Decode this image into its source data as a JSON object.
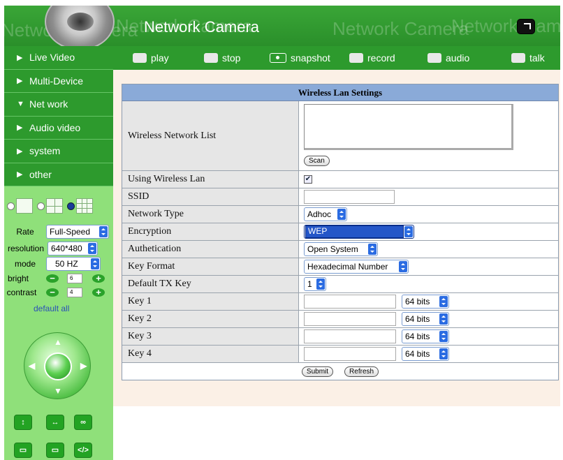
{
  "header": {
    "title": "Network Camera",
    "watermark": "Network Camera"
  },
  "sidebar": {
    "items": [
      {
        "label": "Live Video",
        "arrow": "▶"
      },
      {
        "label": "Multi-Device",
        "arrow": "▶"
      },
      {
        "label": "Net work",
        "arrow": "▼"
      },
      {
        "label": "Audio video",
        "arrow": "▶"
      },
      {
        "label": "system",
        "arrow": "▶"
      },
      {
        "label": "other",
        "arrow": "▶"
      }
    ],
    "controls": {
      "rate_label": "Rate",
      "rate_value": "Full-Speed",
      "resolution_label": "resolution",
      "resolution_value": "640*480",
      "mode_label": "mode",
      "mode_value": "50 HZ",
      "bright_label": "bright",
      "bright_value": "6",
      "contrast_label": "contrast",
      "contrast_value": "4",
      "minus": "−",
      "plus": "+"
    },
    "default_all": "default all",
    "ptz_buttons": [
      "↕",
      "↔",
      "∞",
      "▭",
      "▭",
      "</>"
    ]
  },
  "toolbar": {
    "play": "play",
    "stop": "stop",
    "snapshot": "snapshot",
    "record": "record",
    "audio": "audio",
    "talk": "talk"
  },
  "wireless": {
    "title": "Wireless Lan Settings",
    "network_list_label": "Wireless Network List",
    "scan_label": "Scan",
    "using_label": "Using Wireless Lan",
    "using_checked": "✔",
    "ssid_label": "SSID",
    "network_type_label": "Network Type",
    "network_type_value": "Adhoc",
    "encryption_label": "Encryption",
    "encryption_value": "WEP",
    "auth_label": "Authetication",
    "auth_value": "Open System",
    "key_format_label": "Key Format",
    "key_format_value": "Hexadecimal Number",
    "default_tx_label": "Default TX Key",
    "default_tx_value": "1",
    "keys": [
      {
        "label": "Key 1",
        "bits": "64 bits"
      },
      {
        "label": "Key 2",
        "bits": "64 bits"
      },
      {
        "label": "Key 3",
        "bits": "64 bits"
      },
      {
        "label": "Key 4",
        "bits": "64 bits"
      }
    ],
    "submit_label": "Submit",
    "refresh_label": "Refresh"
  },
  "colors": {
    "header_green": "#2d9a2d",
    "sidebar_light": "#8fe07a",
    "table_header": "#8aaad8",
    "selected_blue": "#2456c8"
  }
}
